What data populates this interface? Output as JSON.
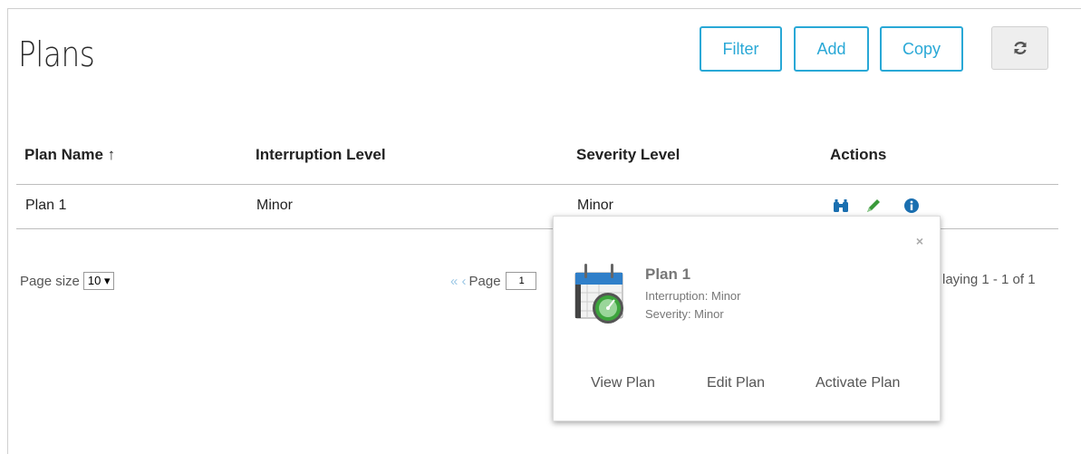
{
  "header": {
    "title": "Plans",
    "filter_label": "Filter",
    "add_label": "Add",
    "copy_label": "Copy"
  },
  "table": {
    "columns": [
      "Plan Name ↑",
      "Interruption Level",
      "Severity Level",
      "Actions"
    ],
    "rows": [
      {
        "name": "Plan 1",
        "interruption": "Minor",
        "severity": "Minor"
      }
    ]
  },
  "pagination": {
    "page_size_label": "Page size",
    "page_size_value": "10 ▾",
    "page_label": "Page",
    "page_value": "1",
    "display_text": "laying 1 - 1 of 1"
  },
  "popup": {
    "close_glyph": "×",
    "title": "Plan 1",
    "interruption": "Interruption: Minor",
    "severity": "Severity: Minor",
    "view_label": "View Plan",
    "edit_label": "Edit Plan",
    "activate_label": "Activate Plan"
  },
  "icons": {
    "view": "binoculars-icon",
    "edit": "pencil-icon",
    "info": "info-icon",
    "refresh": "refresh-icon",
    "calendar": "calendar-gauge-icon"
  },
  "colors": {
    "accent": "#29a8d6",
    "pencil": "#3a9a3a",
    "info": "#1a6fb0"
  }
}
